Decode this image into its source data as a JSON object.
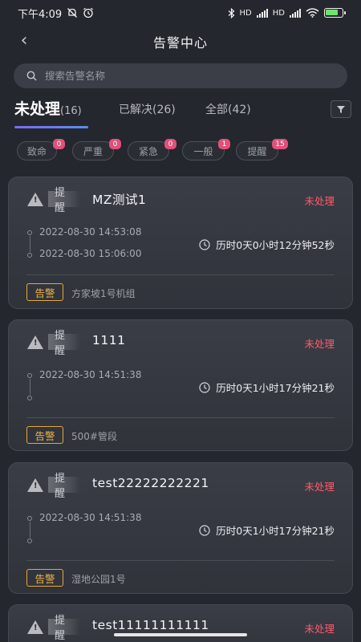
{
  "status_bar": {
    "time": "下午4:09",
    "network_1": "HD",
    "network_2": "HD"
  },
  "header": {
    "title": "告警中心",
    "back_symbol": "‹"
  },
  "search": {
    "placeholder": "搜索告警名称"
  },
  "tabs": [
    {
      "label": "未处理",
      "count": "(16)",
      "active": true
    },
    {
      "label": "已解决",
      "count": "(26)",
      "active": false
    },
    {
      "label": "全部",
      "count": "(42)",
      "active": false
    }
  ],
  "chips": [
    {
      "label": "致命",
      "count": "0"
    },
    {
      "label": "严重",
      "count": "0"
    },
    {
      "label": "紧急",
      "count": "0"
    },
    {
      "label": "一般",
      "count": "1"
    },
    {
      "label": "提醒",
      "count": "15"
    }
  ],
  "cards": [
    {
      "level": "提醒",
      "title": "MZ测试1",
      "status": "未处理",
      "start_time": "2022-08-30 14:53:08",
      "end_time": "2022-08-30 15:06:00",
      "duration": "历时0天0小时12分钟52秒",
      "tag": "告警",
      "location": "方家坡1号机组"
    },
    {
      "level": "提醒",
      "title": "1111",
      "status": "未处理",
      "start_time": "2022-08-30 14:51:38",
      "end_time": "",
      "duration": "历时0天1小时17分钟21秒",
      "tag": "告警",
      "location": "500#管段"
    },
    {
      "level": "提醒",
      "title": "test22222222221",
      "status": "未处理",
      "start_time": "2022-08-30 14:51:38",
      "end_time": "",
      "duration": "历时0天1小时17分钟21秒",
      "tag": "告警",
      "location": "湿地公园1号"
    },
    {
      "level": "提醒",
      "title": "test11111111111",
      "status": "未处理"
    }
  ],
  "warning_glyph": "!",
  "colors": {
    "accent": "#7b6cf0",
    "status_red": "#ff5a6e",
    "tag_orange": "#f0b34a",
    "badge_pink": "#e0517a",
    "battery_green": "#6ee36e"
  },
  "battery_level": 0.8
}
